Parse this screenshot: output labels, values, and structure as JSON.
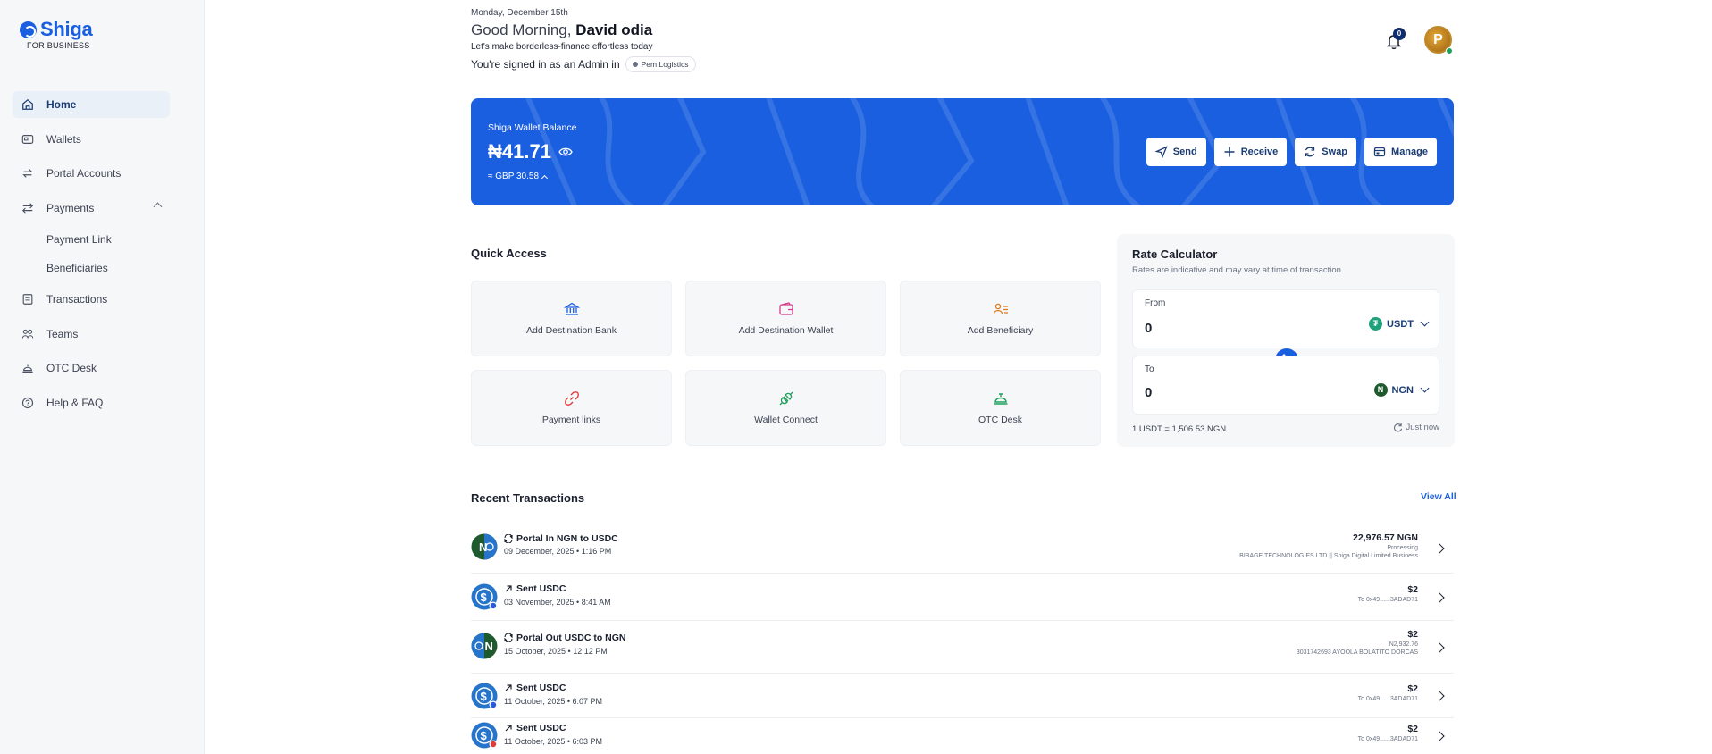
{
  "brand": {
    "name": "Shiga",
    "tagline": "FOR BUSINESS",
    "color": "#1a5fe0"
  },
  "sidebar": {
    "items": [
      {
        "label": "Home",
        "icon": "home-icon",
        "active": true
      },
      {
        "label": "Wallets",
        "icon": "wallet-icon"
      },
      {
        "label": "Portal Accounts",
        "icon": "portal-icon"
      },
      {
        "label": "Payments",
        "icon": "transfer-icon",
        "expanded": true
      },
      {
        "label": "Transactions",
        "icon": "document-icon"
      },
      {
        "label": "Teams",
        "icon": "team-icon"
      },
      {
        "label": "OTC Desk",
        "icon": "bell-desk-icon"
      },
      {
        "label": "Help & FAQ",
        "icon": "help-icon"
      }
    ],
    "payments_sub": [
      "Payment Link",
      "Beneficiaries"
    ]
  },
  "header": {
    "date": "Monday, December 15th",
    "greeting": "Good Morning,",
    "user_name": "David odia",
    "tagline": "Let's make borderless-finance effortless today",
    "signed_in_text": "You're signed in as an Admin in",
    "org_name": "Pem Logistics",
    "notifications_count": "0",
    "avatar_letter": "P"
  },
  "balance": {
    "label": "Shiga Wallet Balance",
    "amount": "₦41.71",
    "approx": "≈ GBP 30.58",
    "actions": [
      "Send",
      "Receive",
      "Swap",
      "Manage"
    ]
  },
  "quick_access": {
    "title": "Quick Access",
    "tiles": [
      {
        "label": "Add Destination Bank",
        "icon": "bank-icon",
        "color": "#1a5fe0"
      },
      {
        "label": "Add Destination Wallet",
        "icon": "wallet-icon",
        "color": "#d83c8c"
      },
      {
        "label": "Add Beneficiary",
        "icon": "user-list-icon",
        "color": "#e07a1a"
      },
      {
        "label": "Payment links",
        "icon": "link-icon",
        "color": "#e03a3a"
      },
      {
        "label": "Wallet Connect",
        "icon": "plug-icon",
        "color": "#1ea05a"
      },
      {
        "label": "OTC Desk",
        "icon": "bell-desk-icon",
        "color": "#1ea05a"
      }
    ]
  },
  "rate_calculator": {
    "title": "Rate Calculator",
    "subtitle": "Rates are indicative and may vary at time of transaction",
    "from_label": "From",
    "from_value": "0",
    "from_currency": "USDT",
    "to_label": "To",
    "to_value": "0",
    "to_currency": "NGN",
    "rate_text": "1 USDT = 1,506.53 NGN",
    "refresh_text": "Just now"
  },
  "recent_transactions": {
    "title": "Recent Transactions",
    "view_all": "View All",
    "rows": [
      {
        "title": "Portal In NGN to USDC",
        "date": "09 December, 2025 • 1:16 PM",
        "amount": "22,976.57 NGN",
        "line1": "Processing",
        "line2": "BIBAGE TECHNOLOGIES LTD || Shiga Digital Limited Business",
        "kind": "portal-in"
      },
      {
        "title": "Sent USDC",
        "date": "03 November, 2025 • 8:41 AM",
        "amount": "$2",
        "line1": "To 0x49......3ADAD71",
        "line2": "",
        "kind": "sent-base"
      },
      {
        "title": "Portal Out USDC to NGN",
        "date": "15 October, 2025 • 12:12 PM",
        "amount": "$2",
        "line1": "N2,932.76",
        "line2": "3031742693 AYOOLA BOLATITO DORCAS",
        "kind": "portal-out"
      },
      {
        "title": "Sent USDC",
        "date": "11 October, 2025 • 6:07 PM",
        "amount": "$2",
        "line1": "To 0x49......3ADAD71",
        "line2": "",
        "kind": "sent-base"
      },
      {
        "title": "Sent USDC",
        "date": "11 October, 2025 • 6:03 PM",
        "amount": "$2",
        "line1": "To 0x49......3ADAD71",
        "line2": "",
        "kind": "sent-red"
      }
    ]
  }
}
